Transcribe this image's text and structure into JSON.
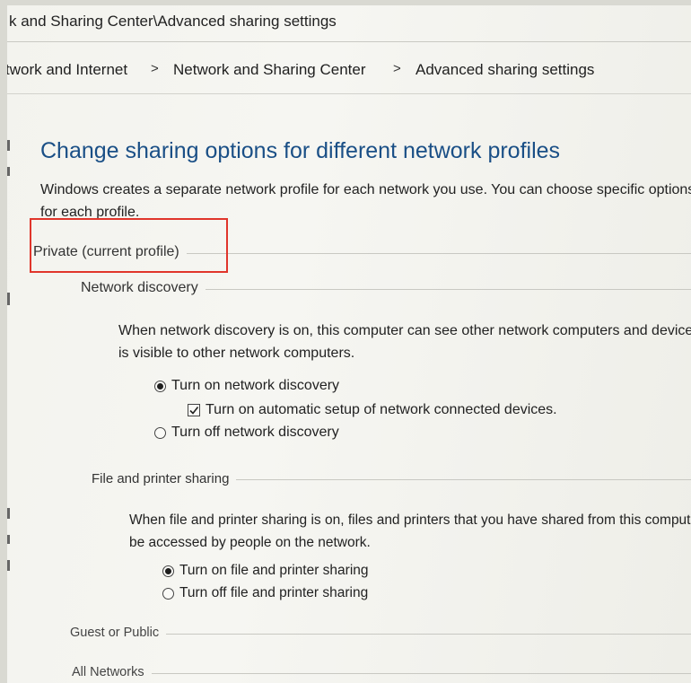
{
  "window": {
    "title": "k and Sharing Center\\Advanced sharing settings"
  },
  "breadcrumb": {
    "items": [
      "twork and Internet",
      "Network and Sharing Center",
      "Advanced sharing settings"
    ],
    "separator": ">"
  },
  "page": {
    "heading": "Change sharing options for different network profiles",
    "description": "Windows creates a separate network profile for each network you use. You can choose specific options for each profile."
  },
  "profiles": {
    "private": {
      "label": "Private (current profile)",
      "network_discovery": {
        "label": "Network discovery",
        "description": "When network discovery is on, this computer can see other network computers and devices and is visible to other network computers.",
        "option_on": "Turn on network discovery",
        "option_on_selected": true,
        "auto_setup": "Turn on automatic setup of network connected devices.",
        "auto_setup_checked": true,
        "option_off": "Turn off network discovery"
      },
      "file_printer": {
        "label": "File and printer sharing",
        "description": "When file and printer sharing is on, files and printers that you have shared from this computer can be accessed by people on the network.",
        "option_on": "Turn on file and printer sharing",
        "option_on_selected": true,
        "option_off": "Turn off file and printer sharing"
      }
    },
    "guest": {
      "label": "Guest or Public"
    },
    "all": {
      "label": "All Networks"
    }
  },
  "colors": {
    "heading": "#1a4f86",
    "highlight": "#e0352b"
  }
}
